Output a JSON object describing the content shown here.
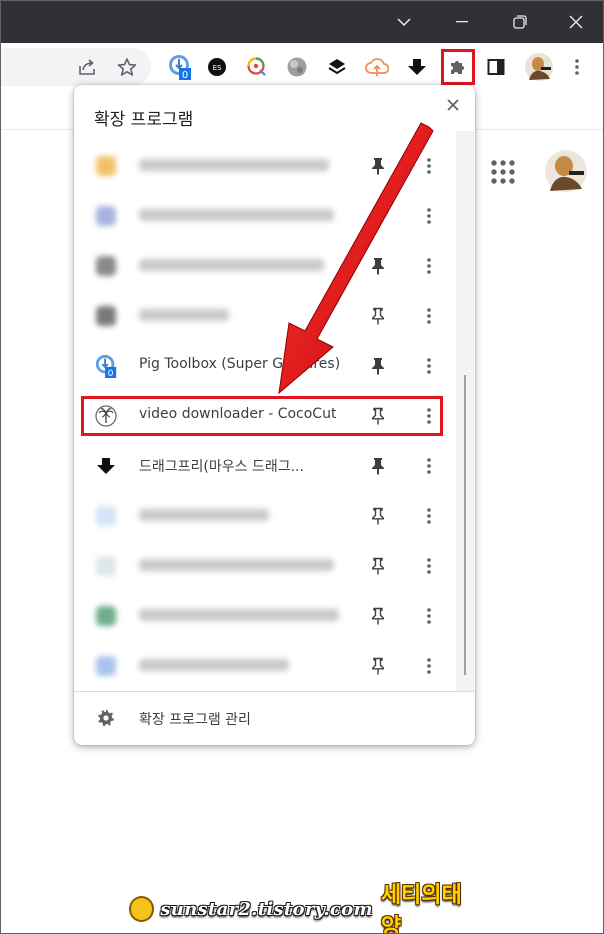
{
  "window": {
    "controls": [
      "chevron-down-icon",
      "minimize-icon",
      "restore-icon",
      "close-icon"
    ]
  },
  "toolbar": {
    "extensions": [
      {
        "name": "pig-toolbox-icon",
        "badge": "0"
      },
      {
        "name": "es-extension-icon"
      },
      {
        "name": "q-extension-icon"
      },
      {
        "name": "globe-extension-icon"
      },
      {
        "name": "layers-extension-icon"
      },
      {
        "name": "cloud-extension-icon"
      },
      {
        "name": "down-arrow-extension-icon"
      }
    ]
  },
  "popup": {
    "title": "확장 프로그램",
    "items": [
      {
        "name": "",
        "pinned": true,
        "blurred": true
      },
      {
        "name": "",
        "pinned": false,
        "blurred": true
      },
      {
        "name": "",
        "pinned": true,
        "blurred": true
      },
      {
        "name": "",
        "pinned": false,
        "blurred": true
      },
      {
        "name": "Pig Toolbox (Super Gestures)",
        "pinned": true,
        "badge": "0"
      },
      {
        "name": "video downloader - CocoCut",
        "pinned": false,
        "highlighted": true
      },
      {
        "name": "드래그프리(마우스 드래그...",
        "pinned": true
      },
      {
        "name": "",
        "pinned": false,
        "blurred": true
      },
      {
        "name": "",
        "pinned": false,
        "blurred": true
      },
      {
        "name": "",
        "pinned": false,
        "blurred": true
      },
      {
        "name": "",
        "pinned": false,
        "blurred": true
      }
    ],
    "footer_label": "확장 프로그램 관리"
  },
  "watermark": {
    "text": "sunstar2.tistory.com",
    "korean": "세티의태양"
  },
  "colors": {
    "annotation_red": "#e0161d",
    "titlebar": "#303134",
    "badge_blue": "#1a73e8"
  }
}
